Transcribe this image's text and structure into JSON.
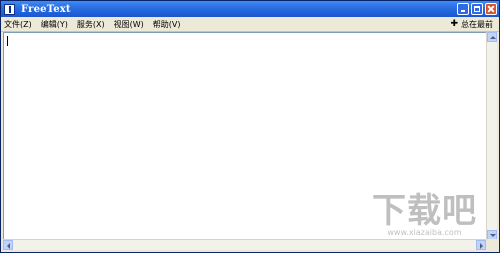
{
  "window": {
    "title": "FreeText"
  },
  "menu": {
    "items": [
      {
        "label": "文件(Z)"
      },
      {
        "label": "编辑(Y)"
      },
      {
        "label": "服务(X)"
      },
      {
        "label": "视图(W)"
      },
      {
        "label": "帮助(V)"
      }
    ],
    "pin_label": "总在最前",
    "pin_icon": "✚"
  },
  "editor": {
    "text": ""
  },
  "watermark": {
    "logo": "下载吧",
    "url": "www.xiazaiba.com"
  },
  "colors": {
    "titlebar": "#2a6fe3",
    "close_button": "#d8532f",
    "menubar": "#ece9d8"
  }
}
